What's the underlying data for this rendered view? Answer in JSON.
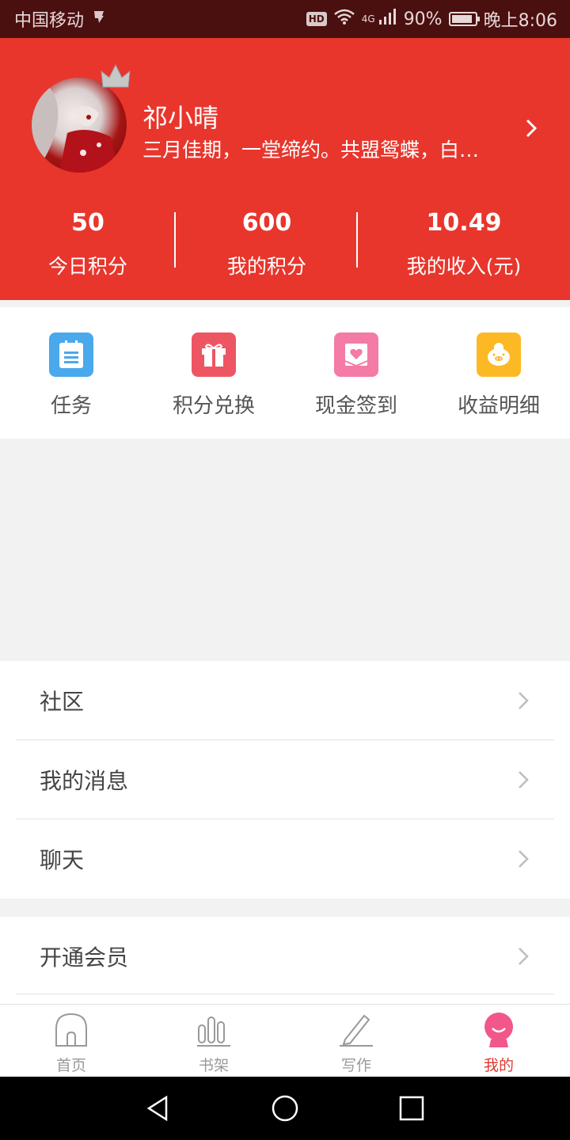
{
  "status_bar": {
    "carrier": "中国移动",
    "hd": "HD",
    "network": "4G",
    "battery": "90%",
    "battery_level": 0.9,
    "time": "晚上8:06"
  },
  "profile": {
    "name": "祁小晴",
    "signature": "三月佳期，一堂缔约。共盟鸳蝶，白…"
  },
  "stats": [
    {
      "value": "50",
      "label": "今日积分"
    },
    {
      "value": "600",
      "label": "我的积分"
    },
    {
      "value": "10.49",
      "label": "我的收入(元)"
    }
  ],
  "actions": [
    {
      "label": "任务",
      "icon": "clipboard-icon",
      "color": "#4aa8ec"
    },
    {
      "label": "积分兑换",
      "icon": "gift-icon",
      "color": "#ee5563"
    },
    {
      "label": "现金签到",
      "icon": "heart-envelope-icon",
      "color": "#f37ba6"
    },
    {
      "label": "收益明细",
      "icon": "piggy-bank-icon",
      "color": "#fdb924"
    }
  ],
  "menu_section_1": [
    {
      "label": "社区"
    },
    {
      "label": "我的消息"
    },
    {
      "label": "聊天"
    }
  ],
  "menu_section_2": [
    {
      "label": "开通会员"
    }
  ],
  "bottom_nav": [
    {
      "label": "首页",
      "icon": "home-icon",
      "active": false
    },
    {
      "label": "书架",
      "icon": "bookshelf-icon",
      "active": false
    },
    {
      "label": "写作",
      "icon": "pencil-icon",
      "active": false
    },
    {
      "label": "我的",
      "icon": "profile-icon",
      "active": true
    }
  ],
  "colors": {
    "header_red": "#e8362d",
    "status_bar": "#4a0f0f",
    "active_nav": "#e0382f"
  }
}
